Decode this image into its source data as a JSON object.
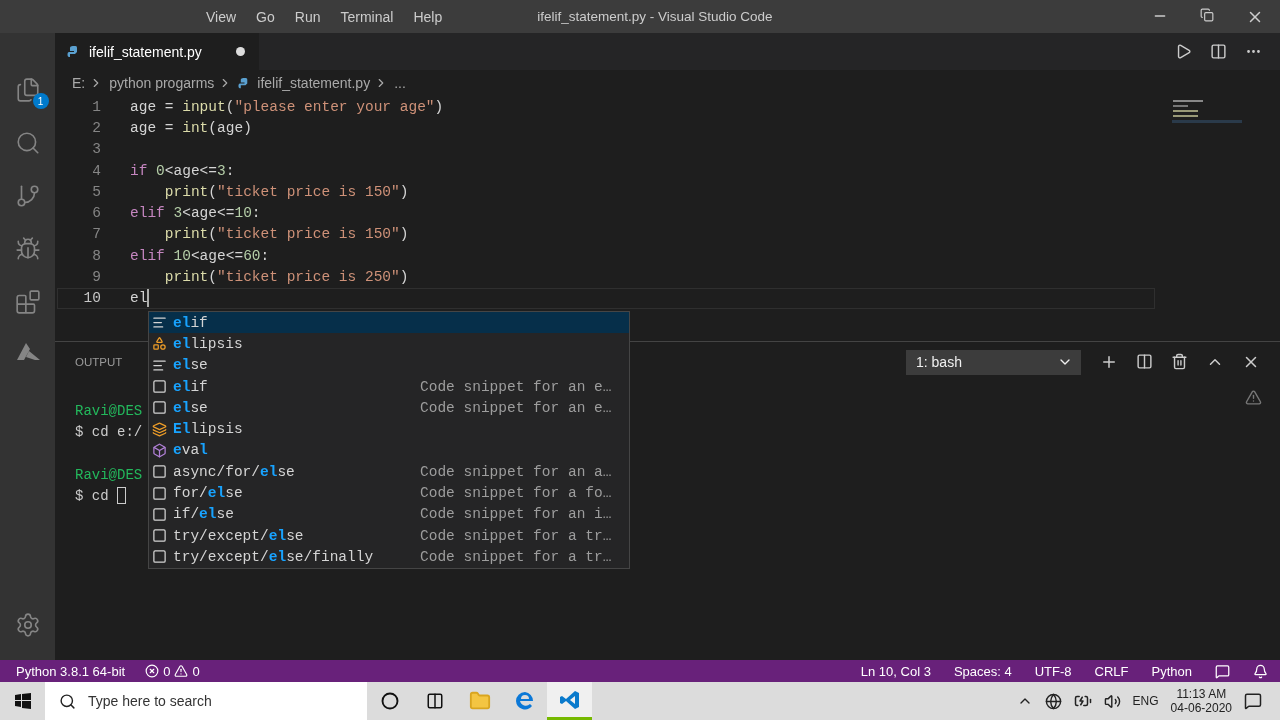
{
  "title_bar": {
    "menu": [
      "View",
      "Go",
      "Run",
      "Terminal",
      "Help"
    ],
    "title": "ifelif_statement.py - Visual Studio Code"
  },
  "activity_bar": {
    "explorer_badge": "1"
  },
  "tabs": [
    {
      "label": "ifelif_statement.py",
      "selected": true,
      "dirty": true
    }
  ],
  "breadcrumbs": [
    "E:",
    "python progarms",
    "ifelif_statement.py",
    "..."
  ],
  "code_lines": [
    {
      "number": "1",
      "current": false,
      "tokens": [
        {
          "kind": "plain",
          "text": "age = "
        },
        {
          "kind": "function",
          "text": "input"
        },
        {
          "kind": "plain",
          "text": "("
        },
        {
          "kind": "string",
          "text": "\"please enter your age\""
        },
        {
          "kind": "plain",
          "text": ")"
        }
      ]
    },
    {
      "number": "2",
      "current": false,
      "tokens": [
        {
          "kind": "plain",
          "text": "age = "
        },
        {
          "kind": "function",
          "text": "int"
        },
        {
          "kind": "plain",
          "text": "(age)"
        }
      ]
    },
    {
      "number": "3",
      "current": false
    },
    {
      "number": "4",
      "current": false,
      "tokens": [
        {
          "kind": "keyword",
          "text": "if "
        },
        {
          "kind": "number",
          "text": "0"
        },
        {
          "kind": "plain",
          "text": "<age<="
        },
        {
          "kind": "number",
          "text": "3"
        },
        {
          "kind": "plain",
          "text": ":"
        }
      ]
    },
    {
      "number": "5",
      "current": false,
      "tokens": [
        {
          "kind": "function",
          "text": "    print"
        },
        {
          "kind": "plain",
          "text": "("
        },
        {
          "kind": "string",
          "text": "\"ticket price is 150\""
        },
        {
          "kind": "plain",
          "text": ")"
        }
      ]
    },
    {
      "number": "6",
      "current": false,
      "tokens": [
        {
          "kind": "keyword",
          "text": "elif "
        },
        {
          "kind": "number",
          "text": "3"
        },
        {
          "kind": "plain",
          "text": "<age<="
        },
        {
          "kind": "number",
          "text": "10"
        },
        {
          "kind": "plain",
          "text": ":"
        }
      ]
    },
    {
      "number": "7",
      "current": false,
      "tokens": [
        {
          "kind": "function",
          "text": "    print"
        },
        {
          "kind": "plain",
          "text": "("
        },
        {
          "kind": "string",
          "text": "\"ticket price is 150\""
        },
        {
          "kind": "plain",
          "text": ")"
        }
      ]
    },
    {
      "number": "8",
      "current": false,
      "tokens": [
        {
          "kind": "keyword",
          "text": "elif "
        },
        {
          "kind": "number",
          "text": "10"
        },
        {
          "kind": "plain",
          "text": "<age<="
        },
        {
          "kind": "number",
          "text": "60"
        },
        {
          "kind": "plain",
          "text": ":"
        }
      ]
    },
    {
      "number": "9",
      "current": false,
      "tokens": [
        {
          "kind": "function",
          "text": "    print"
        },
        {
          "kind": "plain",
          "text": "("
        },
        {
          "kind": "string",
          "text": "\"ticket price is 250\""
        },
        {
          "kind": "plain",
          "text": ")"
        }
      ]
    },
    {
      "number": "10",
      "current": true,
      "tokens": [
        {
          "kind": "plain",
          "text": "el"
        }
      ]
    }
  ],
  "suggestions": [
    {
      "kind": "keyword",
      "selected": true,
      "parts": [
        {
          "text": "el",
          "match": true
        },
        {
          "text": "if",
          "match": false
        }
      ]
    },
    {
      "kind": "class",
      "selected": false,
      "parts": [
        {
          "text": "el",
          "match": true
        },
        {
          "text": "lipsis",
          "match": false
        }
      ]
    },
    {
      "kind": "keyword",
      "selected": false,
      "parts": [
        {
          "text": "el",
          "match": true
        },
        {
          "text": "se",
          "match": false
        }
      ]
    },
    {
      "kind": "snippet",
      "selected": false,
      "parts": [
        {
          "text": "el",
          "match": true
        },
        {
          "text": "if",
          "match": false
        }
      ],
      "detail": "Code snippet for an e…"
    },
    {
      "kind": "snippet",
      "selected": false,
      "parts": [
        {
          "text": "el",
          "match": true
        },
        {
          "text": "se",
          "match": false
        }
      ],
      "detail": "Code snippet for an e…"
    },
    {
      "kind": "variable",
      "selected": false,
      "parts": [
        {
          "text": "El",
          "match": true
        },
        {
          "text": "lipsis",
          "match": false
        }
      ]
    },
    {
      "kind": "module",
      "selected": false,
      "parts": [
        {
          "text": "e",
          "match": true
        },
        {
          "text": "va",
          "match": false
        },
        {
          "text": "l",
          "match": true
        }
      ]
    },
    {
      "kind": "snippet",
      "selected": false,
      "parts": [
        {
          "text": "async/for/",
          "match": false
        },
        {
          "text": "el",
          "match": true
        },
        {
          "text": "se",
          "match": false
        }
      ],
      "detail": "Code snippet for an a…"
    },
    {
      "kind": "snippet",
      "selected": false,
      "parts": [
        {
          "text": "for/",
          "match": false
        },
        {
          "text": "el",
          "match": true
        },
        {
          "text": "se",
          "match": false
        }
      ],
      "detail": "Code snippet for a fo…"
    },
    {
      "kind": "snippet",
      "selected": false,
      "parts": [
        {
          "text": "if/",
          "match": false
        },
        {
          "text": "el",
          "match": true
        },
        {
          "text": "se",
          "match": false
        }
      ],
      "detail": "Code snippet for an i…"
    },
    {
      "kind": "snippet",
      "selected": false,
      "parts": [
        {
          "text": "try/except/",
          "match": false
        },
        {
          "text": "el",
          "match": true
        },
        {
          "text": "se",
          "match": false
        }
      ],
      "detail": "Code snippet for a tr…"
    },
    {
      "kind": "snippet",
      "selected": false,
      "parts": [
        {
          "text": "try/except/",
          "match": false
        },
        {
          "text": "el",
          "match": true
        },
        {
          "text": "se/finally",
          "match": false
        }
      ],
      "detail": "Code snippet for a tr…"
    }
  ],
  "panel": {
    "tabs": [
      {
        "label": "OUTPUT",
        "selected": false
      }
    ],
    "terminal_select": "1: bash",
    "terminal_lines": [
      {
        "kind": "prompt",
        "text": "Ravi@DES"
      },
      {
        "kind": "command",
        "text": "$ cd e:/"
      },
      {
        "kind": "blank"
      },
      {
        "kind": "prompt",
        "text": "Ravi@DES"
      },
      {
        "kind": "input",
        "text": "$ cd"
      }
    ]
  },
  "status_bar": {
    "left": [
      "Python 3.8.1 64-bit"
    ],
    "errors": "0",
    "warnings": "0",
    "right": [
      "Ln 10, Col 3",
      "Spaces: 4",
      "UTF-8",
      "CRLF",
      "Python"
    ]
  },
  "taskbar": {
    "search_placeholder": "Type here to search",
    "apps": [
      {
        "kind": "cortana",
        "selected": false
      },
      {
        "kind": "taskview",
        "selected": false
      },
      {
        "kind": "explorer",
        "selected": false
      },
      {
        "kind": "edge",
        "selected": false
      },
      {
        "kind": "vscode",
        "selected": true
      }
    ],
    "language": "ENG",
    "time": "11:13 AM",
    "date": "04-06-2020"
  }
}
